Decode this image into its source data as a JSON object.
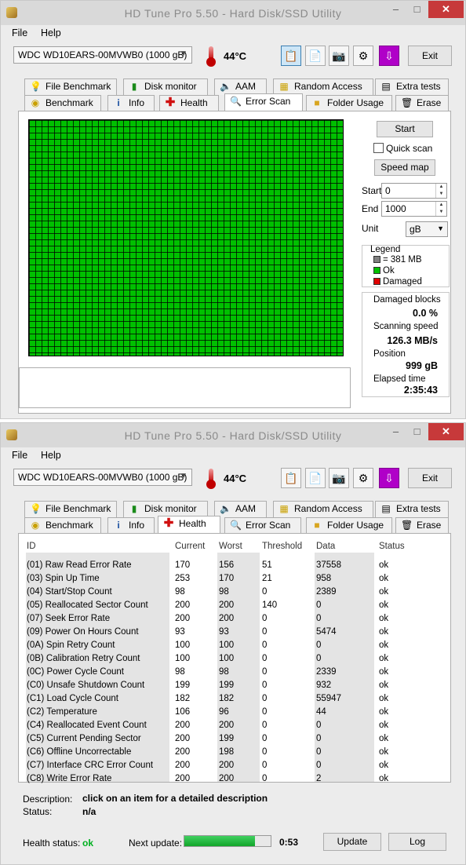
{
  "app": {
    "title": "HD Tune Pro 5.50 - Hard Disk/SSD Utility",
    "menu": [
      "File",
      "Help"
    ],
    "drive": "WDC WD10EARS-00MVWB0 (1000 gB)",
    "temperature": "44",
    "temperature_unit": "°C",
    "exit_label": "Exit"
  },
  "tabs": {
    "row1": [
      "File Benchmark",
      "Disk monitor",
      "AAM",
      "Random Access",
      "Extra tests"
    ],
    "row2": [
      "Benchmark",
      "Info",
      "Health",
      "Error Scan",
      "Folder Usage",
      "Erase"
    ]
  },
  "error_scan": {
    "start_button": "Start",
    "quick_scan_label": "Quick scan",
    "quick_scan_checked": false,
    "speed_map_button": "Speed map",
    "start_label": "Start",
    "start_value": "0",
    "end_label": "End",
    "end_value": "1000",
    "unit_label": "Unit",
    "unit_value": "gB",
    "legend": {
      "title": "Legend",
      "block": "= 381 MB",
      "ok": "Ok",
      "damaged": "Damaged",
      "colors": {
        "block": "#808080",
        "ok": "#00c000",
        "damaged": "#e00000"
      }
    },
    "stats": {
      "damaged_blocks_label": "Damaged blocks",
      "damaged_blocks": "0.0 %",
      "speed_label": "Scanning speed",
      "speed": "126.3 MB/s",
      "position_label": "Position",
      "position": "999 gB",
      "elapsed_label": "Elapsed time",
      "elapsed": "2:35:43"
    },
    "grid_color": "#00c000"
  },
  "health": {
    "columns": [
      "ID",
      "Current",
      "Worst",
      "Threshold",
      "Data",
      "Status"
    ],
    "rows": [
      {
        "id": "(01) Raw Read Error Rate",
        "current": "170",
        "worst": "156",
        "threshold": "51",
        "data": "37558",
        "status": "ok"
      },
      {
        "id": "(03) Spin Up Time",
        "current": "253",
        "worst": "170",
        "threshold": "21",
        "data": "958",
        "status": "ok"
      },
      {
        "id": "(04) Start/Stop Count",
        "current": "98",
        "worst": "98",
        "threshold": "0",
        "data": "2389",
        "status": "ok"
      },
      {
        "id": "(05) Reallocated Sector Count",
        "current": "200",
        "worst": "200",
        "threshold": "140",
        "data": "0",
        "status": "ok"
      },
      {
        "id": "(07) Seek Error Rate",
        "current": "200",
        "worst": "200",
        "threshold": "0",
        "data": "0",
        "status": "ok"
      },
      {
        "id": "(09) Power On Hours Count",
        "current": "93",
        "worst": "93",
        "threshold": "0",
        "data": "5474",
        "status": "ok"
      },
      {
        "id": "(0A) Spin Retry Count",
        "current": "100",
        "worst": "100",
        "threshold": "0",
        "data": "0",
        "status": "ok"
      },
      {
        "id": "(0B) Calibration Retry Count",
        "current": "100",
        "worst": "100",
        "threshold": "0",
        "data": "0",
        "status": "ok"
      },
      {
        "id": "(0C) Power Cycle Count",
        "current": "98",
        "worst": "98",
        "threshold": "0",
        "data": "2339",
        "status": "ok"
      },
      {
        "id": "(C0) Unsafe Shutdown Count",
        "current": "199",
        "worst": "199",
        "threshold": "0",
        "data": "932",
        "status": "ok"
      },
      {
        "id": "(C1) Load Cycle Count",
        "current": "182",
        "worst": "182",
        "threshold": "0",
        "data": "55947",
        "status": "ok"
      },
      {
        "id": "(C2) Temperature",
        "current": "106",
        "worst": "96",
        "threshold": "0",
        "data": "44",
        "status": "ok"
      },
      {
        "id": "(C4) Reallocated Event Count",
        "current": "200",
        "worst": "200",
        "threshold": "0",
        "data": "0",
        "status": "ok"
      },
      {
        "id": "(C5) Current Pending Sector",
        "current": "200",
        "worst": "199",
        "threshold": "0",
        "data": "0",
        "status": "ok"
      },
      {
        "id": "(C6) Offline Uncorrectable",
        "current": "200",
        "worst": "198",
        "threshold": "0",
        "data": "0",
        "status": "ok"
      },
      {
        "id": "(C7) Interface CRC Error Count",
        "current": "200",
        "worst": "200",
        "threshold": "0",
        "data": "0",
        "status": "ok"
      },
      {
        "id": "(C8) Write Error Rate",
        "current": "200",
        "worst": "200",
        "threshold": "0",
        "data": "2",
        "status": "ok"
      }
    ],
    "description_label": "Description:",
    "description": "click on an item for a detailed description",
    "status_label": "Status:",
    "status": "n/a",
    "health_status_label": "Health status:",
    "health_status": "ok",
    "next_update_label": "Next update:",
    "next_update": "0:53",
    "next_update_progress": 0.82,
    "update_button": "Update",
    "log_button": "Log"
  }
}
